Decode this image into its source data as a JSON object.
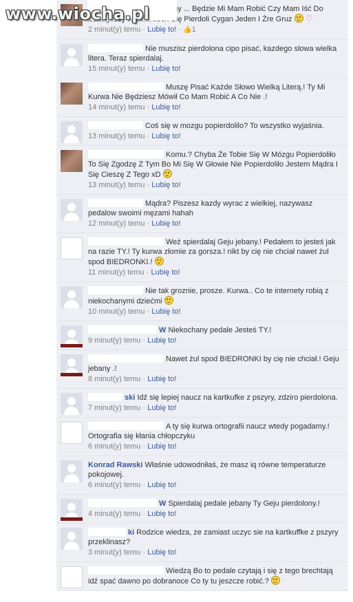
{
  "watermark": "www.wiocha.pl",
  "comments": [
    {
      "text": "... On Jest Jakiś Przyjebany ... Będzie Mi Mam Robić Czy Mam Iść Do Szkoły Czy Nie ... Niech Się Pierdoli Cygan Jeden I Żre Gruz",
      "time": "2 minut(y) temu",
      "like": "Lubię to!",
      "likes": "1",
      "avatar": "photo"
    },
    {
      "author": "",
      "text": "Nie muszisz pierdolona cipo pisać, kazdego slowa wielka litera. Teraz spierdalaj.",
      "time": "15 minut(y) temu",
      "like": "Lubię to!",
      "avatar": "default"
    },
    {
      "author": "",
      "text": "Muszę Pisać Każde Słowo Wielką Literą.! Ty Mi Kurwa Nie Będziesz Mówił Co Mam Robić A Co Nie .!",
      "time": "14 minut(y) temu",
      "like": "Lubię to!",
      "avatar": "photo"
    },
    {
      "author": "",
      "text": "Coś się w mozgu popierdolilo? To wszystko wyjaśnia.",
      "time": "13 minut(y) temu",
      "like": "Lubię to!",
      "avatar": "default"
    },
    {
      "author": "",
      "text": "Komu.? Chyba Że Tobie Się W Mózgu Popierdoliło To Się Zgodzę Z Tym Bo Mi Się W Głowie Nie Popierdoliło Jestem Mądra I Się Cieszę Z Tego xD",
      "time": "13 minut(y) temu",
      "like": "Lubię to!",
      "avatar": "photo"
    },
    {
      "author": "",
      "text": "Mądra? Piszesz kazdy wyrac z wielkiej, nazywasz pedalow swoimi męzami hahah",
      "time": "12 minut(y) temu",
      "like": "Lubię to!",
      "avatar": "default"
    },
    {
      "author": "",
      "text": "Weź spierdalaj Geju jebany.! Pedałem to jesteś jak na razie TY.! Ty kurwa złomie za gorsza.! nikt by cię nie chciał nawet żul spod BIEDRONKI.!",
      "time": "11 minut(y) temu",
      "like": "Lubię to!",
      "avatar": "white"
    },
    {
      "author": "",
      "text": "Nie tak groznie, prosze. Kurwa.. Co te internety robią z niekochanymi dziećmi",
      "time": "10 minut(y) temu",
      "like": "Lubię to!",
      "avatar": "default"
    },
    {
      "author": "W",
      "text": "Niekochany pedale Jesteś TY.!",
      "time": "9 minut(y) temu",
      "like": "Lubię to!",
      "avatar": "redstripe"
    },
    {
      "author": "",
      "text": "Nawet żul spod BIEDRONKI by cię nie chciał.! Geju jebany .!",
      "time": "8 minut(y) temu",
      "like": "Lubię to!",
      "avatar": "redstripe"
    },
    {
      "author": "ski",
      "text": "Idź się lepiej naucz na kartkufke z pszyry, zdziro pierdolona.",
      "time": "7 minut(y) temu",
      "like": "Lubię to!",
      "avatar": "default"
    },
    {
      "author": "",
      "text": "A ty się kurwa ortografii naucz wtedy pogadamy.! Ortografia się kłania chłopczyku",
      "time": "6 minut(y) temu",
      "like": "Lubię to!",
      "avatar": "white"
    },
    {
      "author": "Konrad Rawski",
      "text": "Właśnie udowodniłaś, że masz iq równe temperaturze pokojowej.",
      "time": "6 minut(y) temu",
      "like": "Lubię to!",
      "avatar": "default"
    },
    {
      "author": "W",
      "text": "Spierdalaj pedale jebany Ty Geju pierdolony.!",
      "time": "4 minut(y) temu",
      "like": "Lubię to!",
      "avatar": "redstripe"
    },
    {
      "author": "ki",
      "text": "Rodzice wiedza, ze zamiast uczyc sie na kartkuffke z pszyry przeklinasz?",
      "time": "3 minut(y) temu",
      "like": "Lubię to!",
      "avatar": "default"
    },
    {
      "author": "",
      "text": "Wiedzą Bo to pedale czytają i się z tego brechtają idź spać dawno po dobranoce Co ty tu jeszcze robić.?",
      "time": "",
      "like": "",
      "avatar": "white"
    }
  ]
}
